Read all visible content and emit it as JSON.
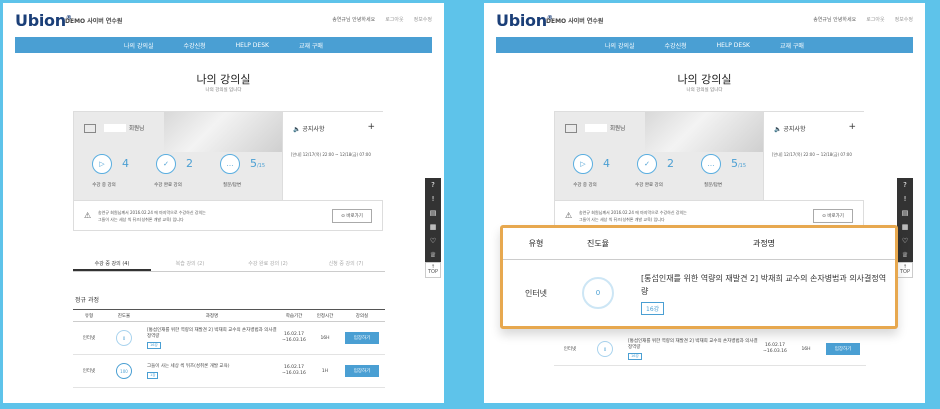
{
  "header": {
    "logo": "Ubion",
    "site_name": "DEMO 사이버 연수원",
    "util": [
      "송연규님 안녕하세요",
      "로그아웃",
      "정보수정"
    ]
  },
  "nav": [
    "나의 강의실",
    "수강신청",
    "HELP DESK",
    "교재 구매"
  ],
  "page": {
    "title": "나의 강의실",
    "subtitle": "나의 강의실 입니다"
  },
  "dashboard": {
    "member_suffix": "회원님",
    "stats": [
      {
        "value": "4",
        "label": "수강 중 강의",
        "icon": "play-icon"
      },
      {
        "value": "2",
        "label": "수강 완료 강의",
        "icon": "check-icon"
      },
      {
        "value": "5",
        "value_suffix": "/15",
        "label": "질문/답변",
        "icon": "chat-icon"
      }
    ],
    "notice": {
      "title": "공지사항",
      "plus": "+",
      "item": "[안내] 12/17(목) 22:00 ~ 12/18(금) 07:00"
    },
    "warning": {
      "line1": "송연규 회원님께서 2016.02.24 에 마지막으로 수강하신 강의는",
      "line2": "그들이 사는 세상 씩 뒤즈(성취론 개발 교육) 입니다",
      "button": "바로가기"
    }
  },
  "tabs": [
    "수강 중 강의 (4)",
    "복습 강의 (2)",
    "수강 완료 강의 (2)",
    "신청 중 강의 (7)"
  ],
  "section_label": "정규 과정",
  "table": {
    "headers": [
      "유형",
      "진도율",
      "과정명",
      "학습기간",
      "인정시간",
      "강의실"
    ],
    "rows": [
      {
        "type": "인터넷",
        "progress": "0",
        "title": "[통섭인재를 위한 역량의 재발견 2] 박재희 교수의 손자병법과 의사결정역량",
        "badge": "16강",
        "start": "16.02.17",
        "end": "~16.03.16",
        "hours": "16H",
        "button": "입장하기"
      },
      {
        "type": "인터넷",
        "progress": "100",
        "title": "그들이 사는 세상 씩 뒤즈(성취론 개발 교육)",
        "badge": "1강",
        "start": "16.02.17",
        "end": "~16.03.16",
        "hours": "1H",
        "button": "입장하기"
      }
    ]
  },
  "quick_menu": {
    "top_label": "TOP"
  },
  "zoom": {
    "headers": [
      "유형",
      "진도율",
      "과정명"
    ],
    "type": "인터넷",
    "progress": "0",
    "title": "[통섭인재를 위한 역량의 재발견 2] 박재희 교수의 손자병법과 의사결정역량",
    "badge": "16강"
  },
  "colors": {
    "background": "#5ec3ea",
    "nav": "#4a9fd3",
    "highlight": "#e7a84f",
    "logo": "#1b3f78"
  }
}
